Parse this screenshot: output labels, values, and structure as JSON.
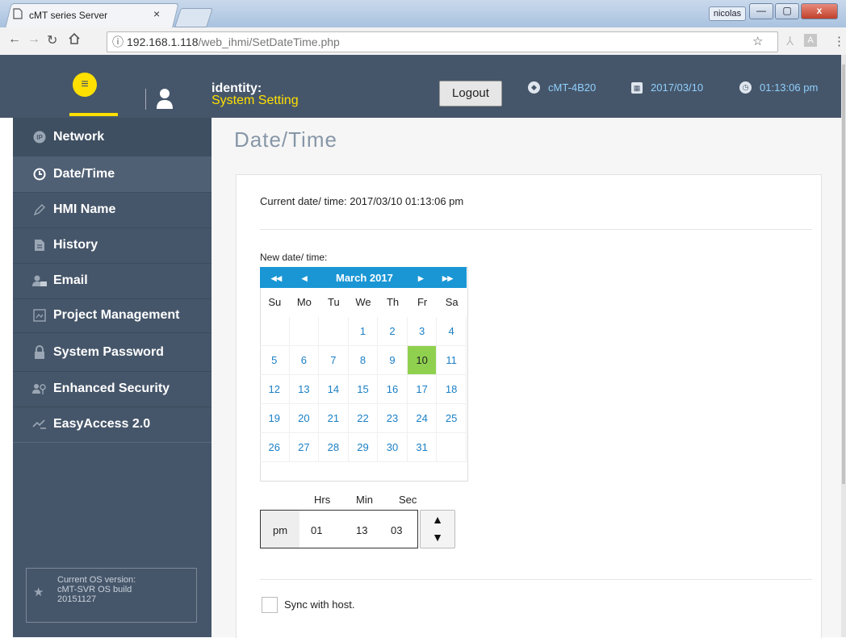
{
  "browser": {
    "tab_title": "cMT series Server",
    "tab_close": "×",
    "user_name": "nicolas",
    "url_host": "192.168.1.118",
    "url_path": "/web_ihmi/SetDateTime.php",
    "window_buttons": [
      "—",
      "▢",
      "x"
    ]
  },
  "header": {
    "identity_label": "identity:",
    "identity_value": "System Setting",
    "logout_label": "Logout",
    "device_name": "cMT-4B20",
    "date": "2017/03/10",
    "time": "01:13:06 pm"
  },
  "sidebar": {
    "items": [
      {
        "label": "Network",
        "icon": "ip-icon"
      },
      {
        "label": "Date/Time",
        "icon": "clock-icon"
      },
      {
        "label": "HMI Name",
        "icon": "pencil-icon"
      },
      {
        "label": "History",
        "icon": "document-icon"
      },
      {
        "label": "Email",
        "icon": "user-group-icon"
      },
      {
        "label": "Project Management",
        "icon": "project-icon"
      },
      {
        "label": "System Password",
        "icon": "lock-icon"
      },
      {
        "label": "Enhanced Security",
        "icon": "users-key-icon"
      },
      {
        "label": "EasyAccess 2.0",
        "icon": "easyaccess-icon"
      }
    ],
    "os_version": {
      "line1": "Current OS version:",
      "line2": "cMT-SVR OS build",
      "line3": "20151127"
    }
  },
  "main": {
    "page_title": "Date/Time",
    "current_label": "Current date/ time: 2017/03/10 01:13:06 pm",
    "new_label": "New date/ time:",
    "calendar": {
      "month_label": "March 2017",
      "prev_year": "◂◂",
      "prev_month": "◂",
      "next_month": "▸",
      "next_year": "▸▸",
      "weekdays": [
        "Su",
        "Mo",
        "Tu",
        "We",
        "Th",
        "Fr",
        "Sa"
      ],
      "weeks": [
        [
          "",
          "",
          "",
          "1",
          "2",
          "3",
          "4"
        ],
        [
          "5",
          "6",
          "7",
          "8",
          "9",
          "10",
          "11"
        ],
        [
          "12",
          "13",
          "14",
          "15",
          "16",
          "17",
          "18"
        ],
        [
          "19",
          "20",
          "21",
          "22",
          "23",
          "24",
          "25"
        ],
        [
          "26",
          "27",
          "28",
          "29",
          "30",
          "31",
          ""
        ]
      ],
      "selected_day": "10"
    },
    "time": {
      "hrs_label": "Hrs",
      "min_label": "Min",
      "sec_label": "Sec",
      "ampm": "pm",
      "hrs": "01",
      "min": "13",
      "sec": "03",
      "spin_up": "▲",
      "spin_down": "▼"
    },
    "sync_label": "Sync with host."
  }
}
